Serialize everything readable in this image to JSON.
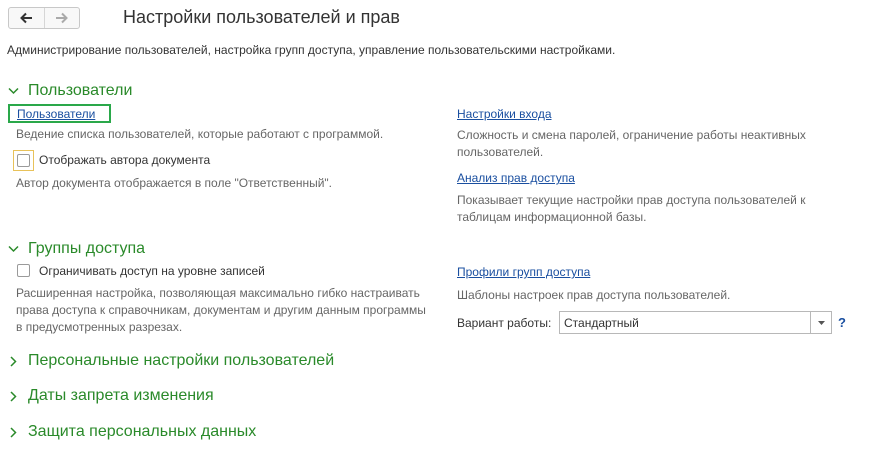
{
  "header": {
    "title": "Настройки пользователей и прав",
    "subtitle": "Администрирование пользователей, настройка групп доступа, управление пользовательскими настройками."
  },
  "sections": {
    "users": {
      "title": "Пользователи",
      "users_link": "Пользователи",
      "users_desc": "Ведение списка пользователей, которые работают с программой.",
      "show_author_label": "Отображать автора документа",
      "show_author_desc": "Автор документа отображается в поле \"Ответственный\".",
      "login_settings_link": "Настройки входа",
      "login_settings_desc": "Сложность и смена паролей, ограничение работы неактивных пользователей.",
      "rights_analysis_link": "Анализ прав доступа",
      "rights_analysis_desc": "Показывает текущие настройки прав доступа пользователей к таблицам информационной базы."
    },
    "access_groups": {
      "title": "Группы доступа",
      "restrict_label": "Ограничивать доступ на уровне записей",
      "restrict_desc": "Расширенная настройка, позволяющая максимально гибко настраивать права доступа к справочникам, документам и другим данным программы в предусмотренных разрезах.",
      "profiles_link": "Профили групп доступа",
      "profiles_desc": "Шаблоны настроек прав доступа пользователей.",
      "mode_label": "Вариант работы:",
      "mode_value": "Стандартный",
      "help": "?"
    },
    "personal_settings": {
      "title": "Персональные настройки пользователей"
    },
    "closing_dates": {
      "title": "Даты запрета изменения"
    },
    "personal_data": {
      "title": "Защита персональных данных"
    }
  },
  "colors": {
    "section": "#2a8a2a",
    "link": "#1a4fa0",
    "focus": "#2aa84a"
  }
}
